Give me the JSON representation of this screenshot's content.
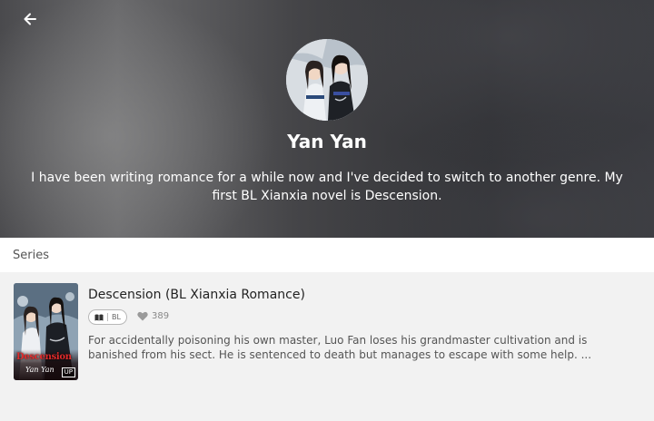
{
  "header": {
    "back_icon": "arrow-left-icon",
    "author_name": "Yan Yan",
    "bio": "I have been writing romance for a while now and I've decided to switch to another genre. My first BL Xianxia novel is Descension."
  },
  "series_section": {
    "label": "Series",
    "books": [
      {
        "title": "Descension (BL Xianxia Romance)",
        "tag": "BL",
        "likes": "389",
        "synopsis": "For accidentally poisoning his own master, Luo Fan loses his grandmaster cultivation and is banished from his sect. He is sentenced to death but manages to escape with some help. ...",
        "cover": {
          "title": "Descension",
          "author": "Yan Yan",
          "badge": "UP"
        }
      }
    ]
  },
  "colors": {
    "hero_text": "#ffffff",
    "cover_title": "#e22b2b",
    "page_bg": "#f2f2f2"
  }
}
